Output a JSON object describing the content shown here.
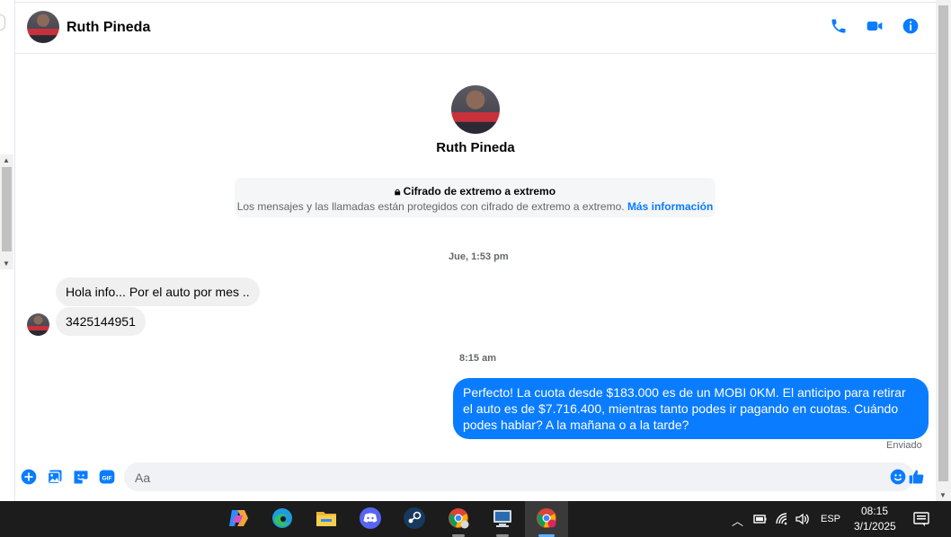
{
  "header": {
    "contact_name": "Ruth Pineda"
  },
  "profile": {
    "name": "Ruth Pineda"
  },
  "encryption": {
    "title": "Cifrado de extremo a extremo",
    "text": "Los mensajes y las llamadas están protegidos con cifrado de extremo a extremo.",
    "link": "Más información"
  },
  "conversation": {
    "timestamp_1": "Jue, 1:53 pm",
    "incoming": [
      {
        "text": "Hola info... Por el auto por mes .."
      },
      {
        "text": "3425144951"
      }
    ],
    "timestamp_2": "8:15 am",
    "outgoing": {
      "text": "Perfecto! La cuota desde $183.000 es de un MOBI 0KM. El anticipo para retirar el auto es de $7.716.400, mientras tanto podes ir pagando en cuotas. Cuándo podes hablar? A la mañana o a la tarde?"
    },
    "sent_status": "Enviado"
  },
  "composer": {
    "placeholder": "Aa"
  },
  "taskbar": {
    "language": "ESP",
    "time": "08:15",
    "date": "3/1/2025"
  },
  "colors": {
    "accent": "#0a7cff",
    "incoming_bubble": "#f0f0f0",
    "taskbar_bg": "#1c1c1c"
  }
}
